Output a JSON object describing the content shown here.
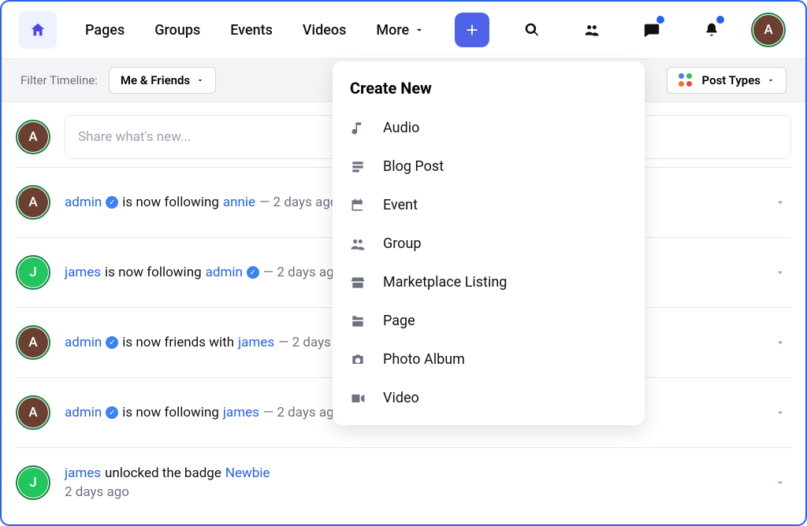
{
  "nav": {
    "links": [
      "Pages",
      "Groups",
      "Events",
      "Videos"
    ],
    "more": "More"
  },
  "filter": {
    "label": "Filter Timeline:",
    "selected": "Me & Friends",
    "post_types": "Post Types"
  },
  "compose": {
    "placeholder": "Share what's new..."
  },
  "create_menu": {
    "title": "Create New",
    "items": [
      {
        "label": "Audio",
        "icon": "audio"
      },
      {
        "label": "Blog Post",
        "icon": "blog"
      },
      {
        "label": "Event",
        "icon": "event"
      },
      {
        "label": "Group",
        "icon": "group"
      },
      {
        "label": "Marketplace Listing",
        "icon": "market"
      },
      {
        "label": "Page",
        "icon": "page"
      },
      {
        "label": "Photo Album",
        "icon": "photo"
      },
      {
        "label": "Video",
        "icon": "video"
      }
    ]
  },
  "current_user_avatar": {
    "letter": "A",
    "color": "brown"
  },
  "feed": [
    {
      "avatar": {
        "letter": "A",
        "color": "brown"
      },
      "actor": "admin",
      "actor_verified": true,
      "verb": "is now following",
      "target": "annie",
      "target_verified": false,
      "time": "2 days ago"
    },
    {
      "avatar": {
        "letter": "J",
        "color": "green"
      },
      "actor": "james",
      "actor_verified": false,
      "verb": "is now following",
      "target": "admin",
      "target_verified": true,
      "time": "2 days ago"
    },
    {
      "avatar": {
        "letter": "A",
        "color": "brown"
      },
      "actor": "admin",
      "actor_verified": true,
      "verb": "is now friends with",
      "target": "james",
      "target_verified": false,
      "time": "2 days ago"
    },
    {
      "avatar": {
        "letter": "A",
        "color": "brown"
      },
      "actor": "admin",
      "actor_verified": true,
      "verb": "is now following",
      "target": "james",
      "target_verified": false,
      "time": "2 days ago"
    },
    {
      "avatar": {
        "letter": "J",
        "color": "green"
      },
      "actor": "james",
      "actor_verified": false,
      "verb_badge": "unlocked the badge",
      "badge": "Newbie",
      "time": "2 days ago"
    }
  ]
}
